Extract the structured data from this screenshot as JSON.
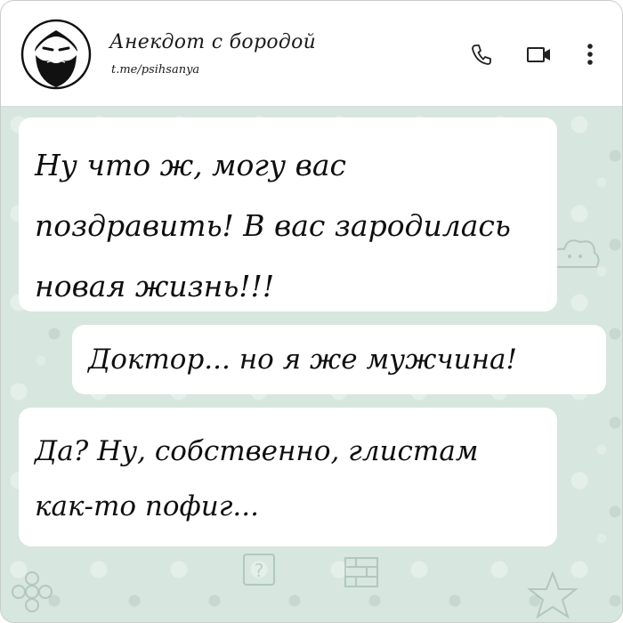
{
  "header": {
    "title": "Анекдот с бородой",
    "subtitle": "t.me/psihsanya",
    "avatar_icon": "bearded-man-avatar-icon",
    "call_icon": "phone-icon",
    "video_icon": "video-camera-icon",
    "menu_icon": "more-vert-icon"
  },
  "messages": [
    {
      "text": "Ну что ж, могу вас поздравить! В вас зародилась новая жизнь!!!",
      "side": "incoming"
    },
    {
      "text": "Доктор... но я же мужчина!",
      "side": "outgoing"
    },
    {
      "text": "Да? Ну, собственно, глистам как-то пофиг...",
      "side": "incoming"
    }
  ],
  "colors": {
    "chat_background": "#d7e6df",
    "bubble": "#ffffff",
    "text": "#0f0f0f"
  }
}
